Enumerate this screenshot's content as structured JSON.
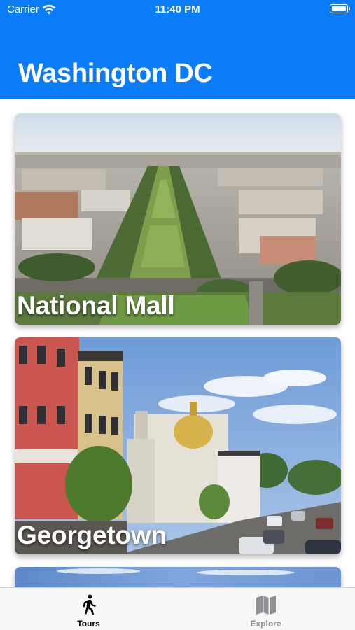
{
  "status_bar": {
    "carrier": "Carrier",
    "time": "11:40 PM"
  },
  "header": {
    "title": "Washington DC",
    "background": "#0a7cf7"
  },
  "tours": [
    {
      "name": "National Mall"
    },
    {
      "name": "Georgetown"
    }
  ],
  "tab_bar": {
    "tabs": [
      {
        "label": "Tours",
        "icon": "walking-person-icon",
        "selected": true
      },
      {
        "label": "Explore",
        "icon": "map-icon",
        "selected": false
      }
    ]
  }
}
